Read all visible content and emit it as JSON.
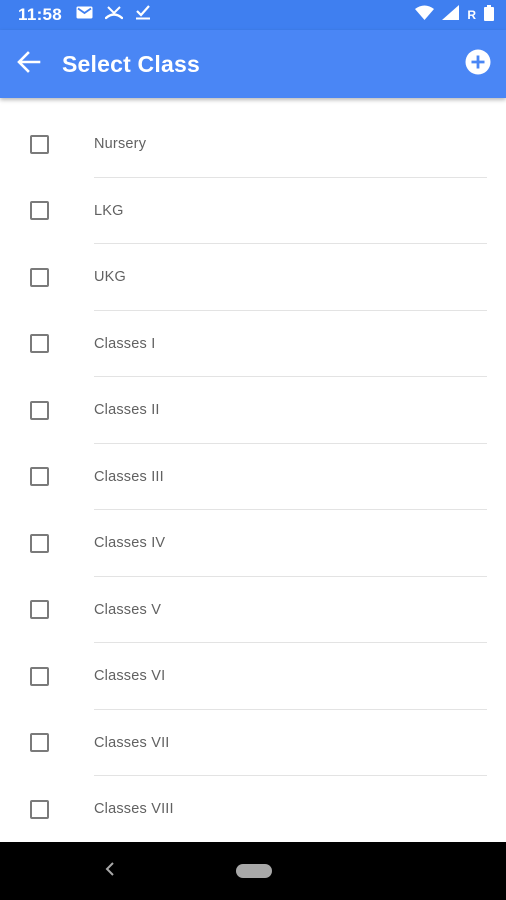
{
  "status_bar": {
    "time": "11:58",
    "left_icons": [
      "gmail-icon",
      "missed-call-icon",
      "download-done-icon"
    ],
    "right_icons": [
      "wifi-icon",
      "signal-icon",
      "battery-icon"
    ],
    "roaming_label": "R"
  },
  "app_bar": {
    "title": "Select Class",
    "back_icon": "arrow-back-icon",
    "add_icon": "add-circle-icon",
    "background_color": "#4a86f5"
  },
  "class_list": {
    "items": [
      {
        "label": "Nursery",
        "checked": false
      },
      {
        "label": "LKG",
        "checked": false
      },
      {
        "label": "UKG",
        "checked": false
      },
      {
        "label": "Classes I",
        "checked": false
      },
      {
        "label": "Classes II",
        "checked": false
      },
      {
        "label": "Classes III",
        "checked": false
      },
      {
        "label": "Classes IV",
        "checked": false
      },
      {
        "label": "Classes V",
        "checked": false
      },
      {
        "label": "Classes VI",
        "checked": false
      },
      {
        "label": "Classes VII",
        "checked": false
      },
      {
        "label": "Classes VIII",
        "checked": false
      }
    ]
  },
  "nav_bar": {
    "back_icon": "nav-back-chevron-icon",
    "home_icon": "nav-home-pill-icon"
  }
}
